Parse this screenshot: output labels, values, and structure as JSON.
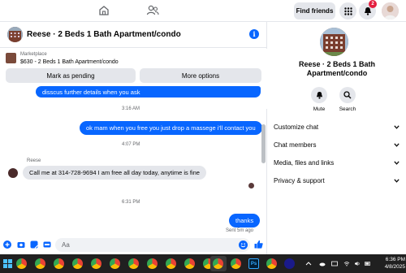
{
  "topbar": {
    "find_friends_label": "Find friends",
    "notification_count": "2",
    "icons": [
      "home-icon",
      "friends-icon",
      "menu-grid-icon",
      "bell-icon",
      "profile-avatar"
    ]
  },
  "chat": {
    "title": "Reese · 2 Beds 1 Bath Apartment/condo",
    "marketplace": {
      "label": "Marketplace",
      "listing": "$630 - 2 Beds 1 Bath Apartment/condo",
      "mark_pending_label": "Mark as pending",
      "more_options_label": "More options"
    },
    "messages": [
      {
        "kind": "outgoing",
        "text": "disscus further details when you ask"
      },
      {
        "kind": "timestamp",
        "text": "3:16 AM"
      },
      {
        "kind": "outgoing",
        "text": "ok mam when you free you just drop a massege i'll contact you"
      },
      {
        "kind": "timestamp",
        "text": "4:07 PM"
      },
      {
        "kind": "sender",
        "text": "Reese"
      },
      {
        "kind": "incoming",
        "text": "Call me at 314-728-9694 I am  free all day today, anytime is fine"
      },
      {
        "kind": "timestamp",
        "text": "6:31 PM"
      },
      {
        "kind": "outgoing",
        "text": "thanks"
      },
      {
        "kind": "status",
        "text": "Sent 5m ago"
      }
    ],
    "composer": {
      "placeholder": "Aa"
    }
  },
  "details": {
    "title": "Reese · 2 Beds 1 Bath Apartment/condo",
    "actions": [
      {
        "label": "Mute",
        "icon": "bell-icon"
      },
      {
        "label": "Search",
        "icon": "search-icon"
      }
    ],
    "sections": [
      {
        "label": "Customize chat"
      },
      {
        "label": "Chat members"
      },
      {
        "label": "Media, files and links"
      },
      {
        "label": "Privacy & support"
      }
    ]
  },
  "taskbar": {
    "time": "6:36 PM",
    "date": "4/8/2025"
  },
  "colors": {
    "accent": "#0866ff",
    "bubble_incoming": "#e4e6eb",
    "badge": "#e41e3f",
    "taskbar": "#202020"
  }
}
